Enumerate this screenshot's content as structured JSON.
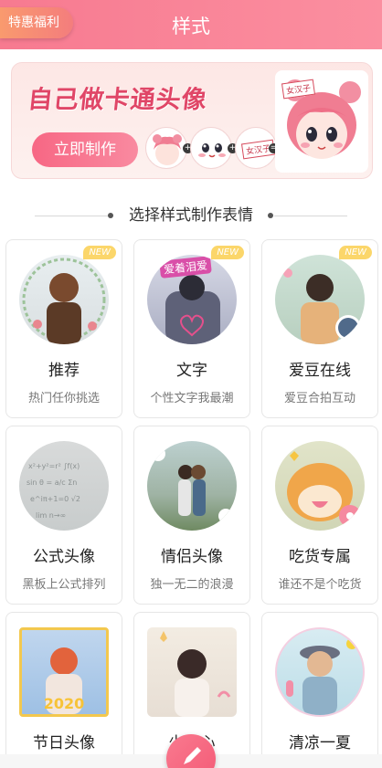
{
  "header": {
    "title": "样式",
    "perk_button": "特惠福利"
  },
  "banner": {
    "title": "自己做卡通头像",
    "cta": "立即制作",
    "tag": "女汉子",
    "step_tag": "女汉子",
    "step_equals": "="
  },
  "section": {
    "title": "选择样式制作表情"
  },
  "cards": [
    {
      "name": "推荐",
      "desc": "热门任你挑选",
      "badge": "NEW"
    },
    {
      "name": "文字",
      "desc": "个性文字我最潮",
      "badge": "NEW",
      "overlay": "爱着泪爱"
    },
    {
      "name": "爱豆在线",
      "desc": "爱豆合拍互动",
      "badge": "NEW"
    },
    {
      "name": "公式头像",
      "desc": "黑板上公式排列"
    },
    {
      "name": "情侣头像",
      "desc": "独一无二的浪漫"
    },
    {
      "name": "吃货专属",
      "desc": "谁还不是个吃货"
    },
    {
      "name": "节日头像",
      "desc": "",
      "overlay": "2020"
    },
    {
      "name": "少女心",
      "desc": ""
    },
    {
      "name": "清凉一夏",
      "desc": ""
    }
  ],
  "colors": {
    "accent": "#f77a90",
    "brand_text": "#e04667",
    "badge": "#fbd66a"
  },
  "icons": {
    "fab": "pencil-icon"
  }
}
